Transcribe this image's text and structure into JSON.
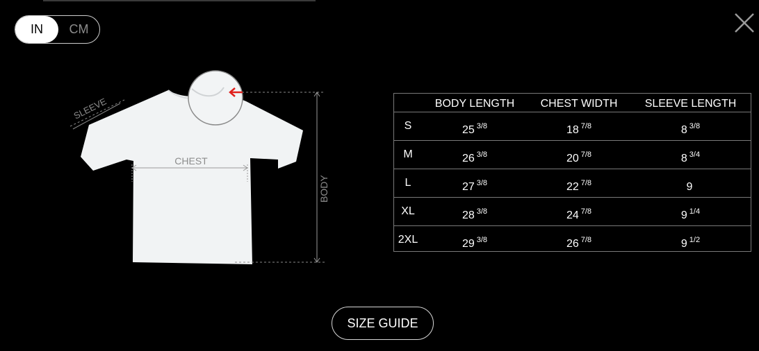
{
  "units": {
    "in_label": "IN",
    "cm_label": "CM",
    "selected": "IN"
  },
  "diagram": {
    "sleeve_label": "SLEEVE",
    "chest_label": "CHEST",
    "body_label": "BODY"
  },
  "table": {
    "headers": [
      "",
      "BODY LENGTH",
      "CHEST WIDTH",
      "SLEEVE LENGTH"
    ],
    "rows": [
      {
        "size": "S",
        "body_whole": "25",
        "body_frac": "3/8",
        "chest_whole": "18",
        "chest_frac": "7/8",
        "sleeve_whole": "8",
        "sleeve_frac": "3/8"
      },
      {
        "size": "M",
        "body_whole": "26",
        "body_frac": "3/8",
        "chest_whole": "20",
        "chest_frac": "7/8",
        "sleeve_whole": "8",
        "sleeve_frac": "3/4"
      },
      {
        "size": "L",
        "body_whole": "27",
        "body_frac": "3/8",
        "chest_whole": "22",
        "chest_frac": "7/8",
        "sleeve_whole": "9",
        "sleeve_frac": ""
      },
      {
        "size": "XL",
        "body_whole": "28",
        "body_frac": "3/8",
        "chest_whole": "24",
        "chest_frac": "7/8",
        "sleeve_whole": "9",
        "sleeve_frac": "1/4"
      },
      {
        "size": "2XL",
        "body_whole": "29",
        "body_frac": "3/8",
        "chest_whole": "26",
        "chest_frac": "7/8",
        "sleeve_whole": "9",
        "sleeve_frac": "1/2"
      }
    ]
  },
  "footer": {
    "size_guide_label": "SIZE GUIDE"
  },
  "icons": {
    "close": "close-icon",
    "arrow": "arrow-left-icon"
  },
  "colors": {
    "background": "#000000",
    "accent_arrow": "#e0201c",
    "shirt": "#f2f4f5"
  }
}
